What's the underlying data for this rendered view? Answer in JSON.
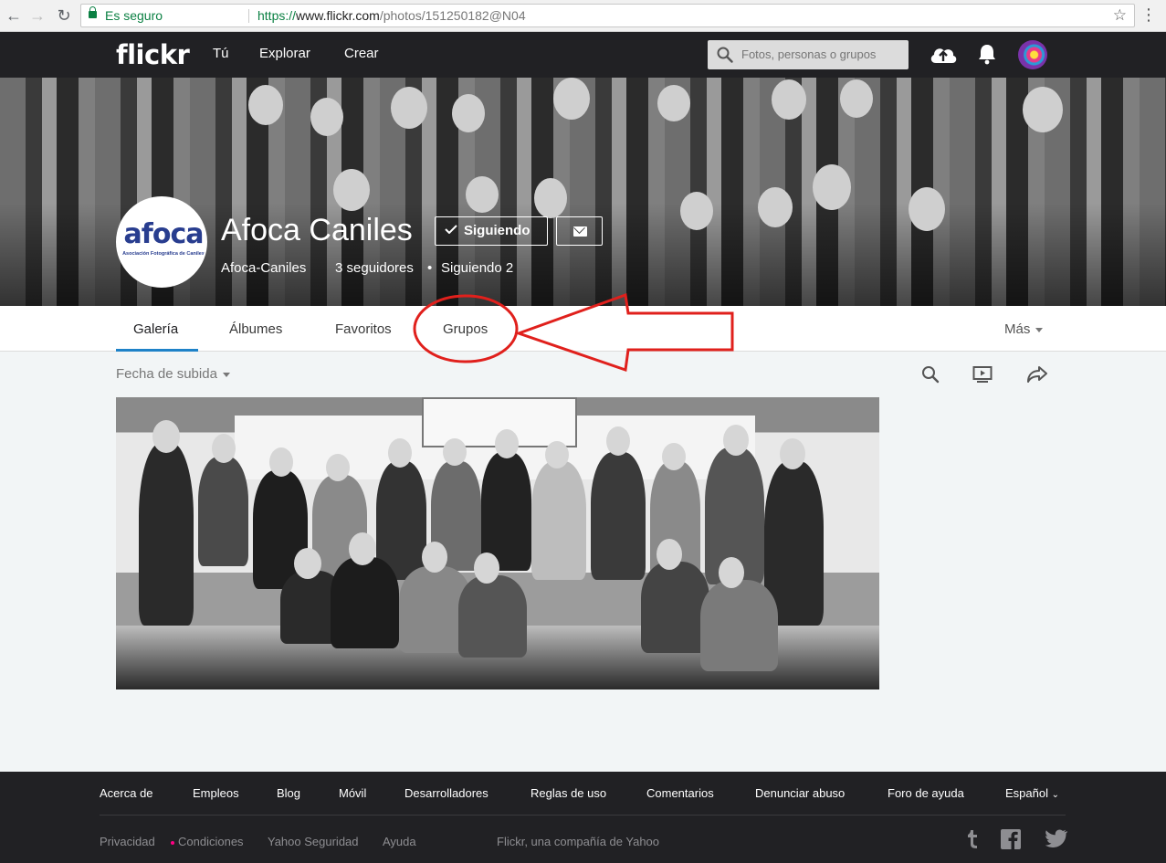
{
  "browser": {
    "secure_label": "Es seguro",
    "url_scheme": "https://",
    "url_host": "www.flickr.com",
    "url_path": "/photos/151250182@N04"
  },
  "header": {
    "logo": "flickr",
    "nav": [
      "Tú",
      "Explorar",
      "Crear"
    ],
    "search_placeholder": "Fotos, personas o grupos"
  },
  "profile": {
    "avatar_text": "afoca",
    "avatar_subtext": "Asociación Fotográfica de Caniles",
    "name": "Afoca Caniles",
    "follow_label": "Siguiendo",
    "username": "Afoca-Caniles",
    "followers": "3 seguidores",
    "following": "Siguiendo 2"
  },
  "tabs": {
    "items": [
      "Galería",
      "Álbumes",
      "Favoritos",
      "Grupos"
    ],
    "active": "Galería",
    "more_label": "Más"
  },
  "toolbar": {
    "sort_label": "Fecha de subida"
  },
  "annotation": {
    "color": "#e0201c",
    "target": "Grupos"
  },
  "footer": {
    "links": [
      "Acerca de",
      "Empleos",
      "Blog",
      "Móvil",
      "Desarrolladores",
      "Reglas de uso",
      "Comentarios",
      "Denunciar abuso",
      "Foro de ayuda",
      "Español"
    ],
    "bottom_links": [
      "Privacidad",
      "Condiciones",
      "Yahoo Seguridad",
      "Ayuda"
    ],
    "company": "Flickr, una compañía de Yahoo"
  },
  "colors": {
    "accent_blue": "#1e82c8",
    "header_bg": "#212124",
    "secure_green": "#0b8043",
    "flickr_pink": "#ff0084"
  }
}
